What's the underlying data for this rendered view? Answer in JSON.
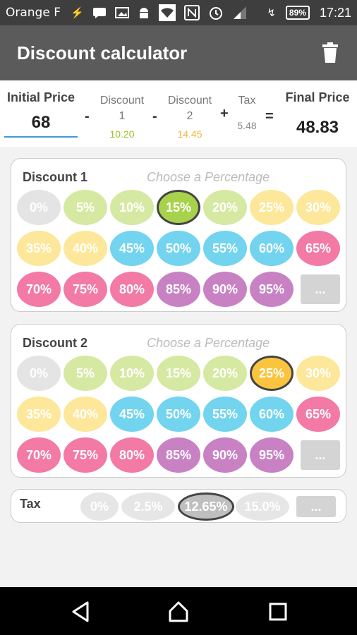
{
  "status_bar": {
    "carrier": "Orange F",
    "battery": "89%",
    "time": "17:21",
    "icons": [
      "usb-icon",
      "chat-icon",
      "image-icon",
      "android-icon",
      "wifi-icon",
      "nfc-icon",
      "alarm-icon",
      "signal-icon",
      "charging-icon"
    ]
  },
  "app_bar": {
    "title": "Discount calculator",
    "action_icon": "trash-icon"
  },
  "summary": {
    "initial_label": "Initial Price",
    "initial_value": "68",
    "minus": "-",
    "plus": "+",
    "equals": "=",
    "discount1_label_1": "Discount",
    "discount1_label_2": "1",
    "discount1_value": "10.20",
    "discount2_label_1": "Discount",
    "discount2_label_2": "2",
    "discount2_value": "14.45",
    "tax_label": "Tax",
    "tax_value": "5.48",
    "final_label": "Final Price",
    "final_value": "48.83"
  },
  "discount1": {
    "title": "Discount 1",
    "hint": "Choose a Percentage",
    "selected": "15%"
  },
  "discount2": {
    "title": "Discount 2",
    "hint": "Choose a Percentage",
    "selected": "25%"
  },
  "percentages": [
    "0%",
    "5%",
    "10%",
    "15%",
    "20%",
    "25%",
    "30%",
    "35%",
    "40%",
    "45%",
    "50%",
    "55%",
    "60%",
    "65%",
    "70%",
    "75%",
    "80%",
    "85%",
    "90%",
    "95%",
    "..."
  ],
  "tax": {
    "title": "Tax",
    "options": [
      "0%",
      "2.5%",
      "12.65%",
      "15.0%",
      "..."
    ],
    "selected": "12.65%"
  },
  "colors": {
    "appbar": "#5b5b5b",
    "gray": "#e4e4e4",
    "light_green": "#d6e9a2",
    "green": "#a8d24b",
    "yellow": "#fde79a",
    "orange": "#fbc43f",
    "pink": "#f27aa5",
    "blue": "#72d4ee",
    "purple": "#c882c4"
  },
  "nav": {
    "back": "back-icon",
    "home": "home-icon",
    "recents": "recents-icon"
  }
}
